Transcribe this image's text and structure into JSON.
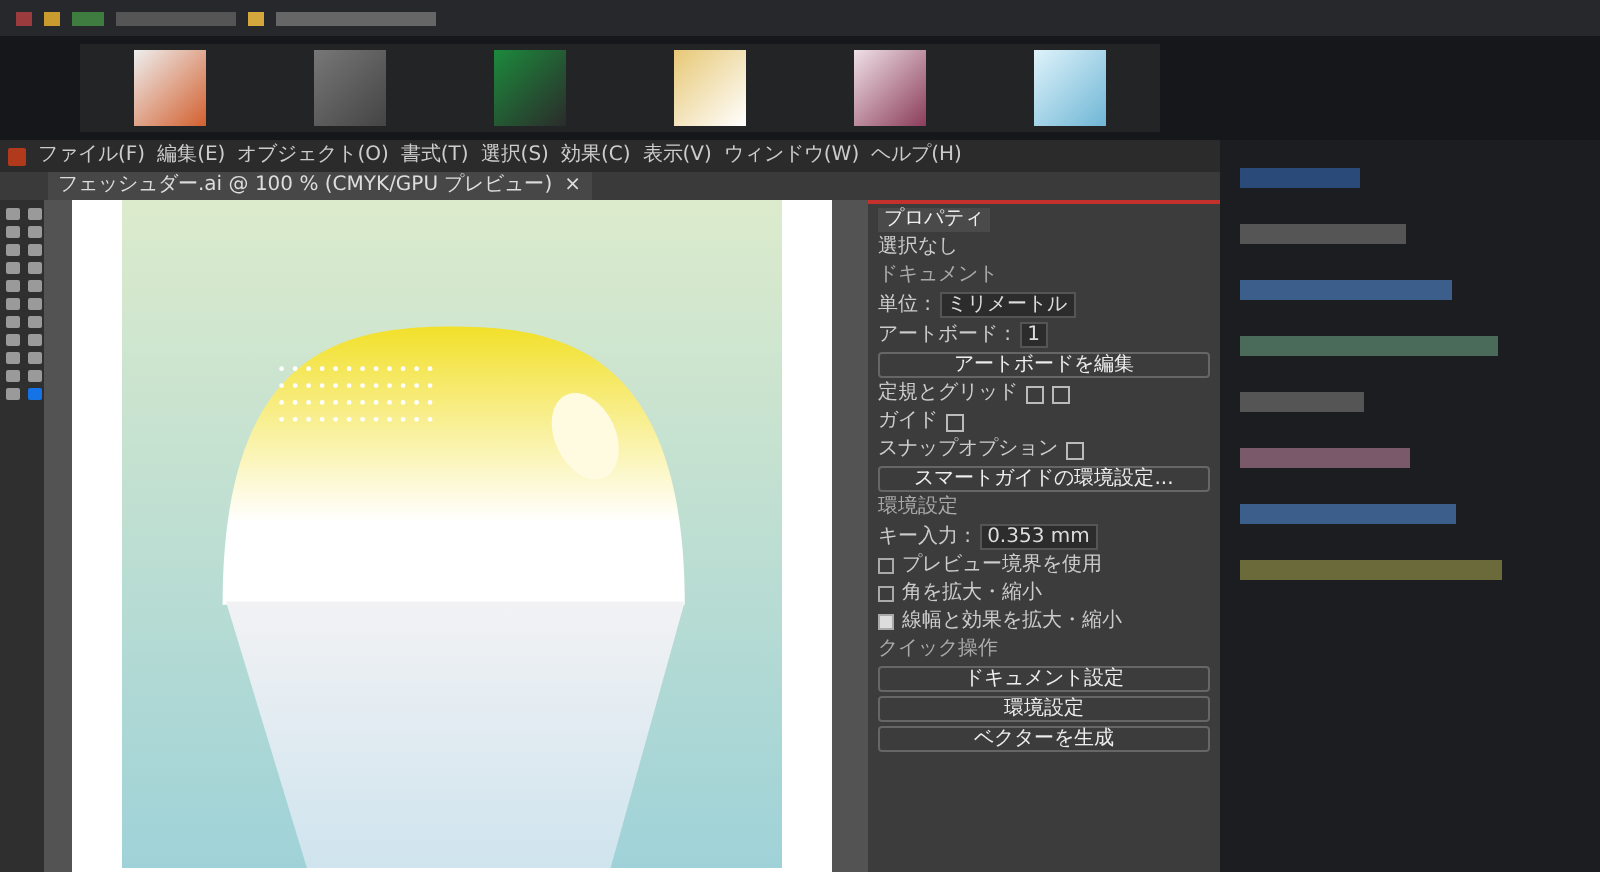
{
  "menu": [
    "ファイル(F)",
    "編集(E)",
    "オブジェクト(O)",
    "書式(T)",
    "選択(S)",
    "効果(C)",
    "表示(V)",
    "ウィンドウ(W)",
    "ヘルプ(H)"
  ],
  "document_tab": {
    "title": "フェッシュダー.ai @ 100 % (CMYK/GPU プレビュー)",
    "close": "×"
  },
  "properties": {
    "tab": "プロパティ",
    "selection": "選択なし",
    "section_document": "ドキュメント",
    "unit_label": "単位 :",
    "unit_value": "ミリメートル",
    "artboard_label": "アートボード :",
    "artboard_value": "1",
    "edit_artboard": "アートボードを編集",
    "rulers_grid": "定規とグリッド",
    "guides": "ガイド",
    "snap_options": "スナップオプション",
    "smart_guides": "スマートガイドの環境設定...",
    "section_prefs": "環境設定",
    "key_increment_label": "キー入力 :",
    "key_increment_value": "0.353 mm",
    "checkboxes": [
      {
        "label": "プレビュー境界を使用",
        "checked": false
      },
      {
        "label": "角を拡大・縮小",
        "checked": false
      },
      {
        "label": "線幅と効果を拡大・縮小",
        "checked": true
      }
    ],
    "section_quick": "クイック操作",
    "quick_buttons": [
      "ドキュメント設定",
      "環境設定",
      "ベクターを生成"
    ]
  }
}
